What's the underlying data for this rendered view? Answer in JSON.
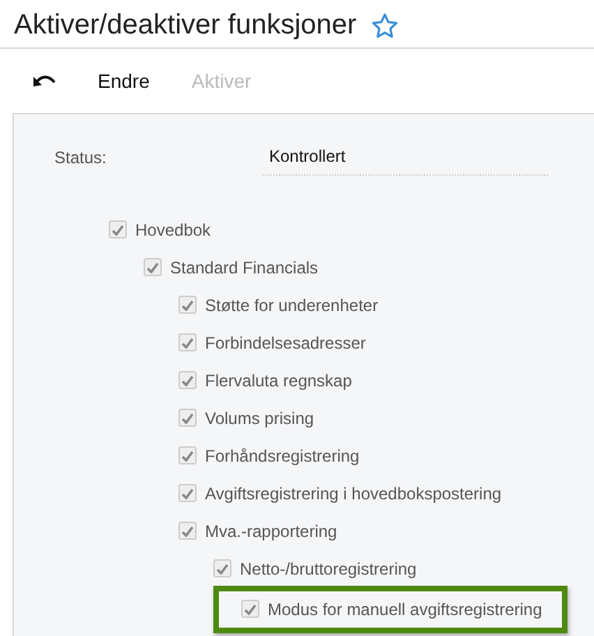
{
  "title": "Aktiver/deaktiver funksjoner",
  "favorite": false,
  "toolbar": [
    {
      "kind": "undo",
      "disabled": false
    },
    {
      "kind": "text",
      "label": "Endre",
      "disabled": false
    },
    {
      "kind": "text",
      "label": "Aktiver",
      "disabled": true
    }
  ],
  "status": {
    "label": "Status:",
    "value": "Kontrollert"
  },
  "tree": [
    {
      "label": "Hovedbok",
      "checked": true,
      "highlighted": false,
      "children": [
        {
          "label": "Standard Financials",
          "checked": true,
          "highlighted": false,
          "children": [
            {
              "label": "Støtte for underenheter",
              "checked": true,
              "highlighted": false
            },
            {
              "label": "Forbindelsesadresser",
              "checked": true,
              "highlighted": false
            },
            {
              "label": "Flervaluta regnskap",
              "checked": true,
              "highlighted": false
            },
            {
              "label": "Volums prising",
              "checked": true,
              "highlighted": false
            },
            {
              "label": "Forhåndsregistrering",
              "checked": true,
              "highlighted": false
            },
            {
              "label": "Avgiftsregistrering i hovedbokspostering",
              "checked": true,
              "highlighted": false
            },
            {
              "label": "Mva.-rapportering",
              "checked": true,
              "highlighted": false,
              "children": [
                {
                  "label": "Netto-/bruttoregistrering",
                  "checked": true,
                  "highlighted": false,
                  "children": [
                    {
                      "label": "Modus for manuell avgiftsregistrering",
                      "checked": true,
                      "highlighted": true
                    }
                  ]
                }
              ]
            }
          ]
        }
      ]
    }
  ]
}
